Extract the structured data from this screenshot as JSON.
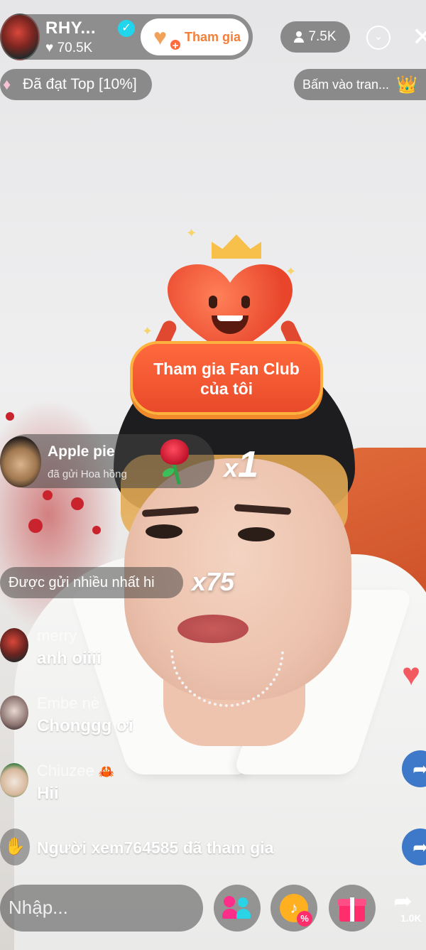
{
  "host": {
    "name": "RHY...",
    "likes": "70.5K",
    "join_button": "Tham gia"
  },
  "viewers": {
    "count": "7.5K"
  },
  "top_rank": {
    "label": "Đã đạt Top [10%]"
  },
  "hint": {
    "label": "Bấm vào tran..."
  },
  "fan_club": {
    "line1": "Tham gia Fan Club",
    "line2": "của tôi"
  },
  "gift_toast": {
    "user": "Apple pie",
    "action": "đã gửi Hoa hồng",
    "combo_x": "x",
    "combo_n": "1"
  },
  "most_sent": {
    "label": "Được gửi nhiều nhất hi",
    "combo": "x75"
  },
  "comments": [
    {
      "user": "merry",
      "text": "anh oiiii"
    },
    {
      "user": "Embe nè",
      "text": "Chonggg ơi"
    },
    {
      "user": "Chiuzee",
      "text": "Hii"
    }
  ],
  "join_message": "Người xem764585 đã tham gia",
  "input": {
    "placeholder": "Nhập..."
  },
  "share": {
    "count": "1.0K"
  },
  "icons": {
    "like": "heart-icon",
    "share": "share-arrow-icon",
    "gift": "gift-icon",
    "people": "people-icon",
    "promo": "promo-icon",
    "close": "close-icon",
    "collapse": "chevron-down-icon"
  }
}
